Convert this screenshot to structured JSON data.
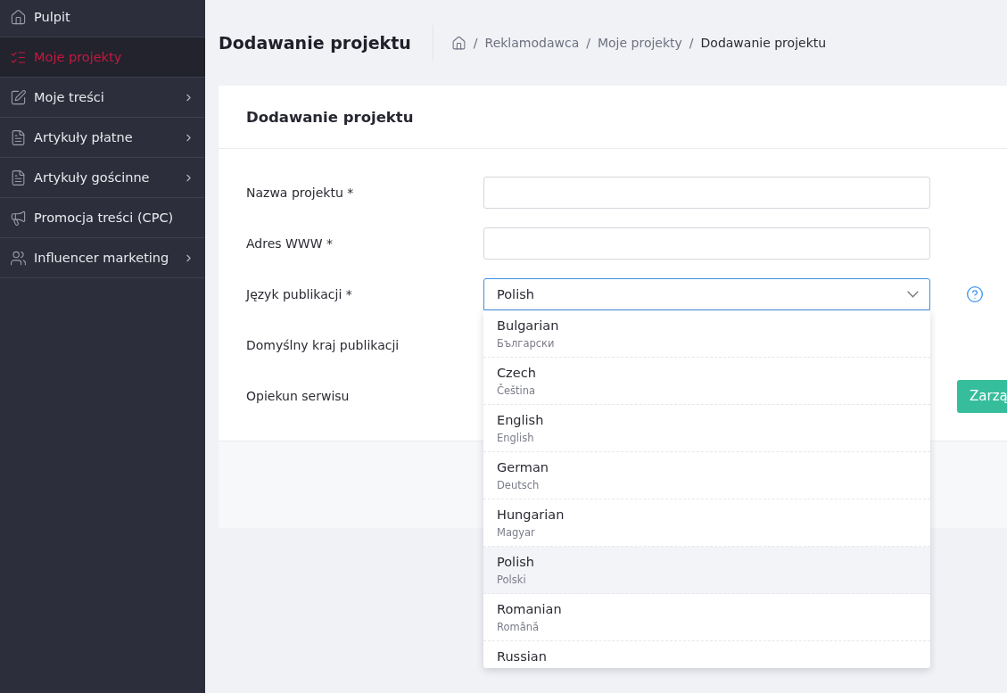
{
  "sidebar": {
    "items": [
      {
        "label": "Pulpit",
        "selected": false,
        "has_submenu": false
      },
      {
        "label": "Moje projekty",
        "selected": true,
        "has_submenu": false
      },
      {
        "label": "Moje treści",
        "selected": false,
        "has_submenu": true
      },
      {
        "label": "Artykuły płatne",
        "selected": false,
        "has_submenu": true
      },
      {
        "label": "Artykuły gościnne",
        "selected": false,
        "has_submenu": true
      },
      {
        "label": "Promocja treści (CPC)",
        "selected": false,
        "has_submenu": false
      },
      {
        "label": "Influencer marketing",
        "selected": false,
        "has_submenu": true
      }
    ]
  },
  "header": {
    "title": "Dodawanie projektu",
    "separator": "/",
    "breadcrumb": [
      "Reklamodawca",
      "Moje projekty",
      "Dodawanie projektu"
    ]
  },
  "card": {
    "title": "Dodawanie projektu",
    "fields": [
      {
        "label": "Nazwa projektu *",
        "kind": "text"
      },
      {
        "label": "Adres WWW *",
        "kind": "text"
      },
      {
        "label": "Język publikacji *",
        "kind": "select",
        "value": "Polish",
        "open": true,
        "help": true
      },
      {
        "label": "Domyślny kraj publikacji",
        "kind": "covered"
      },
      {
        "label": "Opiekun serwisu",
        "kind": "covered",
        "button": "Zarzą"
      }
    ],
    "options": [
      {
        "name": "Bulgarian",
        "native": "Български",
        "selected": false
      },
      {
        "name": "Czech",
        "native": "Čeština",
        "selected": false
      },
      {
        "name": "English",
        "native": "English",
        "selected": false
      },
      {
        "name": "German",
        "native": "Deutsch",
        "selected": false
      },
      {
        "name": "Hungarian",
        "native": "Magyar",
        "selected": false
      },
      {
        "name": "Polish",
        "native": "Polski",
        "selected": true
      },
      {
        "name": "Romanian",
        "native": "Română",
        "selected": false
      },
      {
        "name": "Russian",
        "selected": false
      }
    ]
  }
}
